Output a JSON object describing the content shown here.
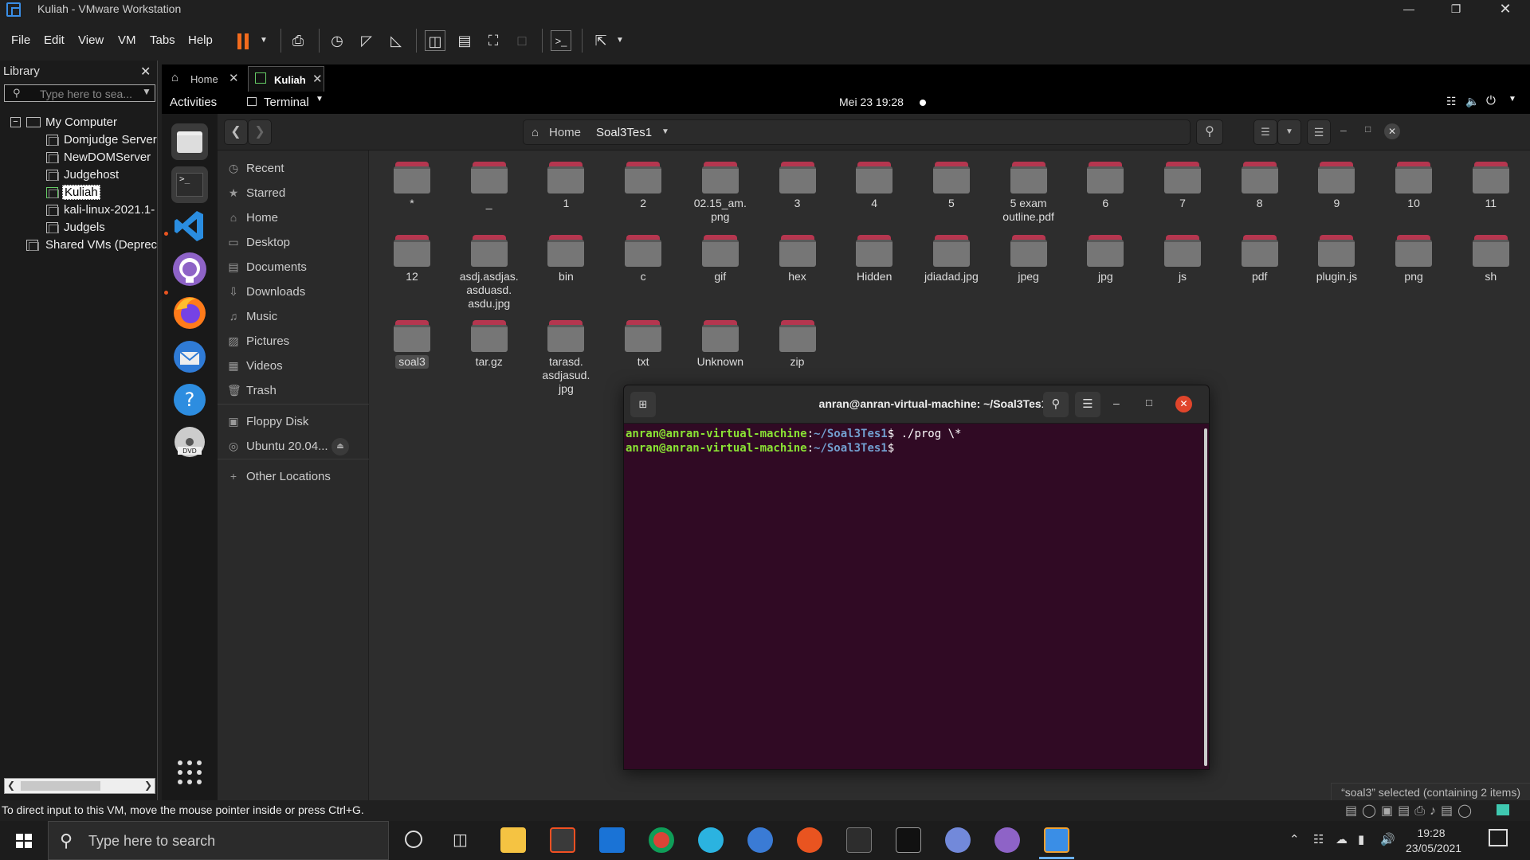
{
  "window": {
    "title": "Kuliah - VMware Workstation",
    "accent": "#f26b1d"
  },
  "menu": [
    "File",
    "Edit",
    "View",
    "VM",
    "Tabs",
    "Help"
  ],
  "library": {
    "title": "Library",
    "search_placeholder": "Type here to sea...",
    "tree": [
      {
        "label": "My Computer",
        "kind": "root"
      },
      {
        "label": "Domjudge Server",
        "kind": "vm"
      },
      {
        "label": "NewDOMServer",
        "kind": "vm"
      },
      {
        "label": "Judgehost",
        "kind": "vm"
      },
      {
        "label": "Kuliah",
        "kind": "vm-selected"
      },
      {
        "label": "kali-linux-2021.1-",
        "kind": "vm"
      },
      {
        "label": "Judgels",
        "kind": "vm"
      },
      {
        "label": "Shared VMs (Deprec",
        "kind": "shared"
      }
    ]
  },
  "vm_tabs": [
    {
      "label": "Home"
    },
    {
      "label": "Kuliah"
    }
  ],
  "gnome": {
    "activities": "Activities",
    "app_menu": "Terminal",
    "clock": "Mei 23  19:28",
    "dock": [
      "files-icon",
      "terminal-icon",
      "vscode-icon",
      "github-icon",
      "firefox-icon",
      "thunderbird-icon",
      "help-icon",
      "dvd-icon"
    ]
  },
  "nautilus": {
    "path": {
      "home": "Home",
      "current": "Soal3Tes1"
    },
    "sidebar": [
      {
        "label": "Recent",
        "icon": "clock-icon",
        "glyph": "◷"
      },
      {
        "label": "Starred",
        "icon": "star-icon",
        "glyph": "★"
      },
      {
        "label": "Home",
        "icon": "home-icon",
        "glyph": "⌂"
      },
      {
        "label": "Desktop",
        "icon": "desktop-icon",
        "glyph": "▭"
      },
      {
        "label": "Documents",
        "icon": "document-icon",
        "glyph": "▤"
      },
      {
        "label": "Downloads",
        "icon": "download-icon",
        "glyph": "⇩"
      },
      {
        "label": "Music",
        "icon": "music-icon",
        "glyph": "♫"
      },
      {
        "label": "Pictures",
        "icon": "picture-icon",
        "glyph": "▨"
      },
      {
        "label": "Videos",
        "icon": "video-icon",
        "glyph": "▦"
      },
      {
        "label": "Trash",
        "icon": "trash-icon",
        "glyph": "🗑"
      },
      {
        "label": "Floppy Disk",
        "icon": "floppy-icon",
        "glyph": "▣"
      },
      {
        "label": "Ubuntu 20.04...",
        "icon": "disc-icon",
        "glyph": "◎"
      },
      {
        "label": "Other Locations",
        "icon": "plus-icon",
        "glyph": "+"
      }
    ],
    "files": [
      "*",
      "_",
      "1",
      "2",
      "02.15_am.\npng",
      "3",
      "4",
      "5",
      "5 exam\noutline.pdf",
      "6",
      "7",
      "8",
      "9",
      "10",
      "11",
      "12",
      "asdj.asdjas.\nasduasd.\nasdu.jpg",
      "bin",
      "c",
      "gif",
      "hex",
      "Hidden",
      "jdiadad.jpg",
      "jpeg",
      "jpg",
      "js",
      "pdf",
      "plugin.js",
      "png",
      "sh",
      "soal3",
      "tar.gz",
      "tarasd.\nasdjasud.\njpg",
      "txt",
      "Unknown",
      "zip"
    ],
    "selected": "soal3",
    "status": "“soal3” selected  (containing 2 items)"
  },
  "terminal": {
    "title": "anran@anran-virtual-machine: ~/Soal3Tes1",
    "lines": [
      {
        "user": "anran@anran-virtual-machine",
        "sep": ":",
        "path": "~/Soal3Tes1",
        "cmd": "$ ./prog \\*"
      },
      {
        "user": "anran@anran-virtual-machine",
        "sep": ":",
        "path": "~/Soal3Tes1",
        "cmd": "$"
      }
    ]
  },
  "vm_status": "To direct input to this VM, move the mouse pointer inside or press Ctrl+G.",
  "taskbar": {
    "search_placeholder": "Type here to search",
    "time": "19:28",
    "date": "23/05/2021"
  }
}
